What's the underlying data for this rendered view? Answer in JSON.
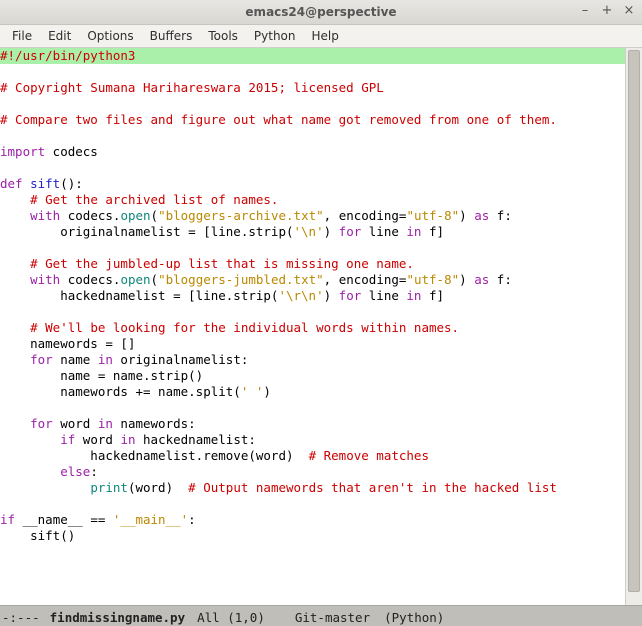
{
  "window": {
    "title": "emacs24@perspective"
  },
  "menu": {
    "file": "File",
    "edit": "Edit",
    "options": "Options",
    "buffers": "Buffers",
    "tools": "Tools",
    "python": "Python",
    "help": "Help"
  },
  "modeline": {
    "state": "-:---",
    "filename": "findmissingname.py",
    "pos": "All (1,0)",
    "vc": "Git-master",
    "mode": "(Python)"
  },
  "code": {
    "l01": {
      "a": "#!/usr/bin/python3"
    },
    "l03": {
      "a": "# Copyright Sumana Harihareswara 2015; licensed GPL"
    },
    "l05": {
      "a": "# Compare two files and figure out what name got removed from one of them."
    },
    "l07": {
      "a": "import",
      "b": " codecs"
    },
    "l09": {
      "a": "def",
      "b": " ",
      "c": "sift",
      "d": "():"
    },
    "l10": {
      "a": "    ",
      "b": "# Get the archived list of names."
    },
    "l11": {
      "a": "    ",
      "b": "with",
      "c": " codecs.",
      "d": "open",
      "e": "(",
      "f": "\"bloggers-archive.txt\"",
      "g": ", encoding=",
      "h": "\"utf-8\"",
      "i": ") ",
      "j": "as",
      "k": " f:"
    },
    "l12": {
      "a": "        originalnamelist = [line.strip(",
      "b": "'\\n'",
      "c": ") ",
      "d": "for",
      "e": " line ",
      "f": "in",
      "g": " f]"
    },
    "l14": {
      "a": "    ",
      "b": "# Get the jumbled-up list that is missing one name."
    },
    "l15": {
      "a": "    ",
      "b": "with",
      "c": " codecs.",
      "d": "open",
      "e": "(",
      "f": "\"bloggers-jumbled.txt\"",
      "g": ", encoding=",
      "h": "\"utf-8\"",
      "i": ") ",
      "j": "as",
      "k": " f:"
    },
    "l16": {
      "a": "        hackednamelist = [line.strip(",
      "b": "'\\r\\n'",
      "c": ") ",
      "d": "for",
      "e": " line ",
      "f": "in",
      "g": " f]"
    },
    "l18": {
      "a": "    ",
      "b": "# We'll be looking for the individual words within names."
    },
    "l19": {
      "a": "    namewords = []"
    },
    "l20": {
      "a": "    ",
      "b": "for",
      "c": " name ",
      "d": "in",
      "e": " originalnamelist:"
    },
    "l21": {
      "a": "        name = name.strip()"
    },
    "l22": {
      "a": "        namewords += name.split(",
      "b": "' '",
      "c": ")"
    },
    "l24": {
      "a": "    ",
      "b": "for",
      "c": " word ",
      "d": "in",
      "e": " namewords:"
    },
    "l25": {
      "a": "        ",
      "b": "if",
      "c": " word ",
      "d": "in",
      "e": " hackednamelist:"
    },
    "l26": {
      "a": "            hackednamelist.remove(word)  ",
      "b": "# Remove matches"
    },
    "l27": {
      "a": "        ",
      "b": "else",
      "c": ":"
    },
    "l28": {
      "a": "            ",
      "b": "print",
      "c": "(word)  ",
      "d": "# Output namewords that aren't in the hacked list"
    },
    "l30": {
      "a": "if",
      "b": " __name__ == ",
      "c": "'__main__'",
      "d": ":"
    },
    "l31": {
      "a": "    sift()"
    }
  }
}
